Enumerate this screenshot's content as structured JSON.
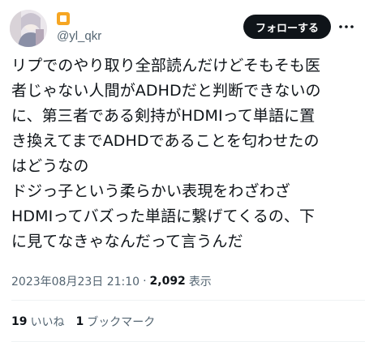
{
  "author": {
    "handle": "@yl_qkr",
    "avatar": "avatar-photo",
    "badge_icon": "profile-badge-icon",
    "badge_color": "#f6a623"
  },
  "follow_button": {
    "label": "フォローする"
  },
  "more_icon": "more-options-icon",
  "tweet": {
    "lines": [
      "リプでのやり取り全部読んだけどそもそも医",
      "者じゃない人間がADHDだと判断できないの",
      "に、第三者である剣持がHDMIって単語に置",
      "き換えてまでADHDであることを匂わせたの",
      "はどうなの",
      "ドジっ子という柔らかい表現をわざわざ",
      "HDMIってバズった単語に繋げてくるの、下",
      "に見てなきゃなんだって言うんだ"
    ]
  },
  "meta": {
    "timestamp": "2023年08月23日 21:10",
    "separator": "·",
    "views_count": "2,092",
    "views_label": "表示"
  },
  "stats": {
    "likes_count": "19",
    "likes_label": "いいね",
    "bookmarks_count": "1",
    "bookmarks_label": "ブックマーク"
  },
  "colors": {
    "text": "#0f1419",
    "secondary": "#536471",
    "button_bg": "#0f1419",
    "divider": "#eff3f4"
  }
}
